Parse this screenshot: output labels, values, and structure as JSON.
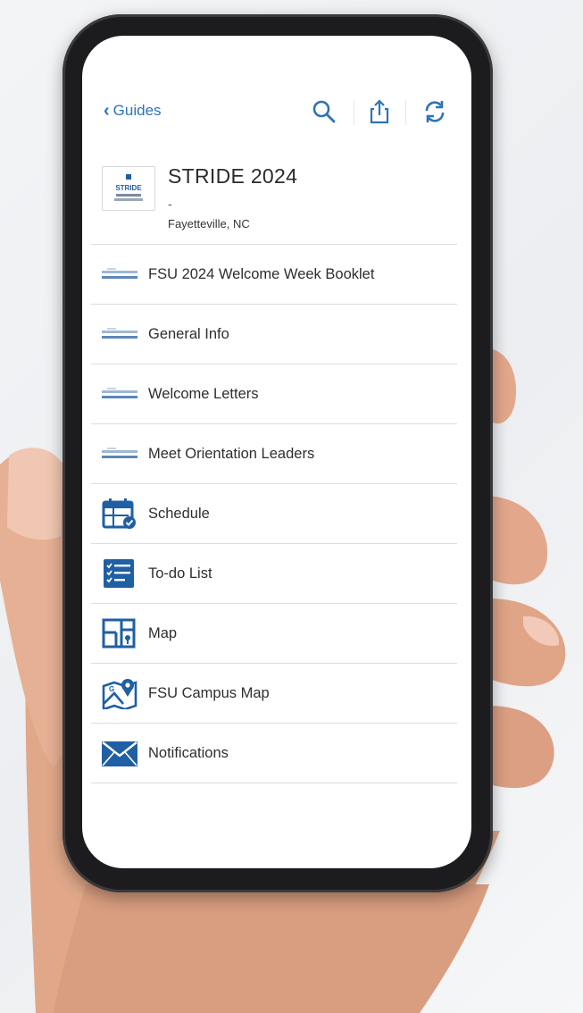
{
  "nav": {
    "back_label": "Guides"
  },
  "toolbar": {
    "icons": [
      "search-icon",
      "share-icon",
      "refresh-icon"
    ]
  },
  "guide": {
    "title": "STRIDE 2024",
    "subtitle": "-",
    "location": "Fayetteville, NC",
    "logo_text": "STRIDE"
  },
  "menu": [
    {
      "label": "FSU 2024 Welcome Week Booklet",
      "icon": "banner-thumbnail-icon"
    },
    {
      "label": "General Info",
      "icon": "banner-thumbnail-icon"
    },
    {
      "label": "Welcome Letters",
      "icon": "banner-thumbnail-icon"
    },
    {
      "label": "Meet Orientation Leaders",
      "icon": "banner-thumbnail-icon"
    },
    {
      "label": "Schedule",
      "icon": "calendar-check-icon"
    },
    {
      "label": "To-do List",
      "icon": "checklist-icon"
    },
    {
      "label": "Map",
      "icon": "floor-map-icon"
    },
    {
      "label": "FSU Campus Map",
      "icon": "map-pin-icon"
    },
    {
      "label": "Notifications",
      "icon": "envelope-icon"
    }
  ],
  "colors": {
    "accent": "#2d74b8",
    "icon_blue": "#1f5fa4",
    "divider": "#d9dde2",
    "text": "#2e2e2e"
  }
}
